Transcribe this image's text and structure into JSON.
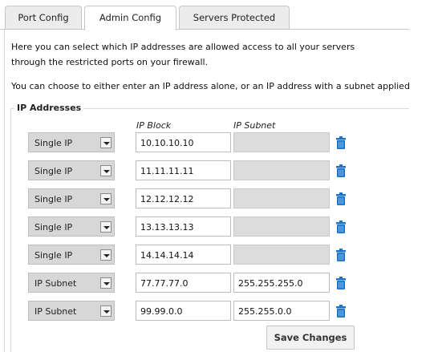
{
  "tabs": [
    {
      "label": "Port Config",
      "active": false
    },
    {
      "label": "Admin Config",
      "active": true
    },
    {
      "label": "Servers Protected",
      "active": false
    }
  ],
  "intro": {
    "line1": "Here you can select which IP addresses are allowed access to all your servers",
    "line2": "through the restricted ports on your firewall.",
    "line3": "You can choose to either enter an IP address alone, or an IP address with a subnet applied"
  },
  "ip_section": {
    "legend": "IP Addresses",
    "col_ip_block": "IP Block",
    "col_ip_subnet": "IP Subnet"
  },
  "rows": [
    {
      "type": "Single IP",
      "ip": "10.10.10.10",
      "subnet": ""
    },
    {
      "type": "Single IP",
      "ip": "11.11.11.11",
      "subnet": ""
    },
    {
      "type": "Single IP",
      "ip": "12.12.12.12",
      "subnet": ""
    },
    {
      "type": "Single IP",
      "ip": "13.13.13.13",
      "subnet": ""
    },
    {
      "type": "Single IP",
      "ip": "14.14.14.14",
      "subnet": ""
    },
    {
      "type": "IP Subnet",
      "ip": "77.77.77.0",
      "subnet": "255.255.255.0"
    },
    {
      "type": "IP Subnet",
      "ip": "99.99.0.0",
      "subnet": "255.255.0.0"
    }
  ],
  "save_label": "Save Changes",
  "colors": {
    "trash_icon": "#1a73c9",
    "disabled_field": "#dcdcdc",
    "select_bg": "#d7d7d7"
  }
}
